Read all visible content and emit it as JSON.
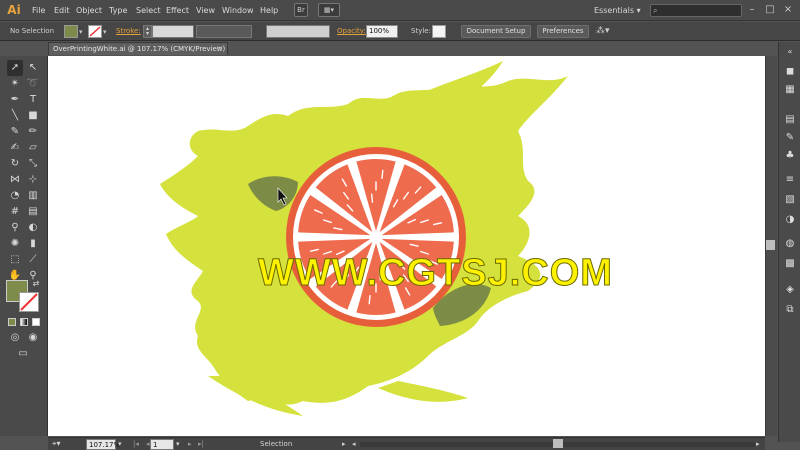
{
  "menubar": {
    "logo": "Ai",
    "items": [
      "File",
      "Edit",
      "Object",
      "Type",
      "Select",
      "Effect",
      "View",
      "Window",
      "Help"
    ],
    "bridge_label": "Br",
    "workspace": "Essentials",
    "search_placeholder": ""
  },
  "controlbar": {
    "selection_label": "No Selection",
    "fill_color": "#7d8c4a",
    "stroke_label": "Stroke:",
    "opacity_label": "Opacity:",
    "opacity_value": "100%",
    "style_label": "Style:",
    "document_setup_label": "Document Setup",
    "preferences_label": "Preferences"
  },
  "document": {
    "tab_title": "OverPrintingWhite.ai @ 107.17% (CMYK/Preview)",
    "close_label": "×"
  },
  "canvas": {
    "splash_color": "#d5e13c",
    "orange_rind_color": "#e75e3b",
    "orange_pith_color": "#ffffff",
    "orange_flesh_color": "#ef6b4e",
    "leaf_color": "#7c8b45",
    "watermark_text": "WWW.CGTSJ.COM"
  },
  "statusbar": {
    "zoom": "107.17%",
    "artboard_number": "1",
    "status_text": "Selection"
  },
  "colors": {
    "accent_link": "#e6a23c",
    "chrome_bg": "#4a4a4a"
  }
}
